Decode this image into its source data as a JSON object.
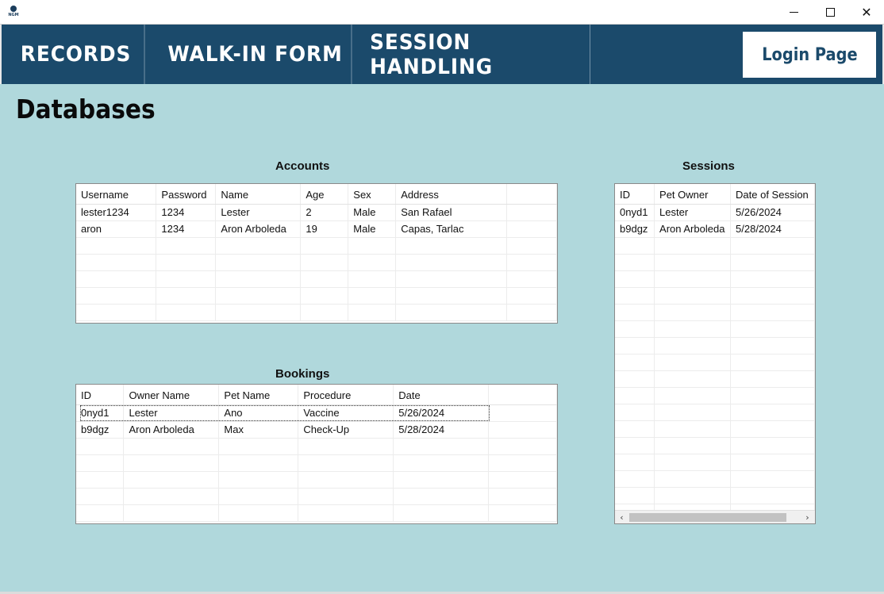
{
  "window": {
    "app_icon_text": "NGM",
    "minimize_icon": "minimize-icon",
    "maximize_icon": "maximize-icon",
    "close_icon": "close-icon",
    "close_glyph": "✕"
  },
  "nav": {
    "records": "RECORDS",
    "walk_in_form": "WALK-IN FORM",
    "session_handling": "SESSION HANDLING",
    "login": "Login Page"
  },
  "page": {
    "title": "Databases"
  },
  "accounts": {
    "title": "Accounts",
    "columns": [
      "Username",
      "Password",
      "Name",
      "Age",
      "Sex",
      "Address"
    ],
    "rows": [
      [
        "lester1234",
        "1234",
        "Lester",
        "2",
        "Male",
        "San Rafael"
      ],
      [
        "aron",
        "1234",
        "Aron Arboleda",
        "19",
        "Male",
        "Capas, Tarlac"
      ]
    ]
  },
  "bookings": {
    "title": "Bookings",
    "columns": [
      "ID",
      "Owner Name",
      "Pet Name",
      "Procedure",
      "Date"
    ],
    "rows": [
      [
        "0nyd1",
        "Lester",
        "Ano",
        "Vaccine",
        "5/26/2024"
      ],
      [
        "b9dgz",
        "Aron Arboleda",
        "Max",
        "Check-Up",
        "5/28/2024"
      ]
    ]
  },
  "sessions": {
    "title": "Sessions",
    "columns": [
      "ID",
      "Pet Owner",
      "Date of Session"
    ],
    "rows": [
      [
        "0nyd1",
        "Lester",
        "5/26/2024"
      ],
      [
        "b9dgz",
        "Aron Arboleda",
        "5/28/2024"
      ]
    ],
    "scroll_left": "‹",
    "scroll_right": "›"
  },
  "colors": {
    "background": "#b0d8dc",
    "navbar": "#1b4a6b",
    "login_text": "#1b4a6b"
  }
}
